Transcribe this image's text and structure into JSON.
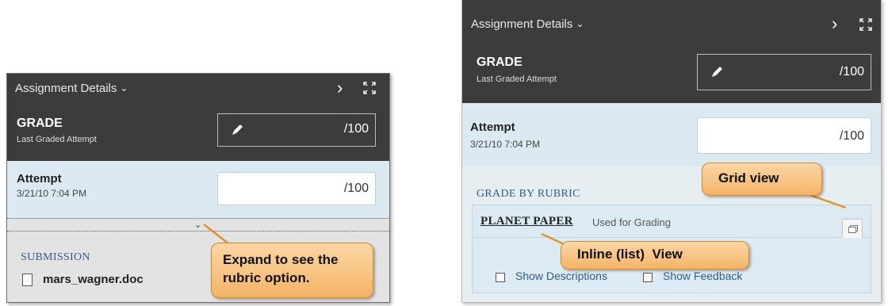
{
  "left_panel": {
    "header_title": "Assignment Details",
    "grade_label": "GRADE",
    "grade_sub": "Last Graded Attempt",
    "grade_value": "/100",
    "attempt_label": "Attempt",
    "attempt_date": "3/21/10 7:04 PM",
    "attempt_value": "/100",
    "submission_heading": "SUBMISSION",
    "file_name": "mars_wagner.doc"
  },
  "right_panel": {
    "header_title": "Assignment Details",
    "grade_label": "GRADE",
    "grade_sub": "Last Graded Attempt",
    "grade_value": "/100",
    "attempt_label": "Attempt",
    "attempt_date": "3/21/10 7:04 PM",
    "attempt_value": "/100",
    "rubric_heading": "GRADE BY RUBRIC",
    "rubric_name": "PLANET PAPER",
    "rubric_used": "Used for Grading",
    "show_descriptions": "Show Descriptions",
    "show_feedback": "Show Feedback"
  },
  "callouts": {
    "expand": "Expand to see the rubric option.",
    "grid_view": "Grid view",
    "inline_view": "Inline (list)  View"
  },
  "icons": {
    "header_chevron": "chevron-down-icon",
    "collapse": "chevron-right-icon",
    "fullscreen": "fullscreen-icon",
    "edit": "pencil-icon",
    "expand": "chevron-down-icon",
    "file": "document-icon",
    "grid_view": "grid-view-icon"
  },
  "colors": {
    "header_bg": "#3c3c3c",
    "attempt_bg": "#dbeaf2",
    "callout_orange": "#f4b466",
    "link_blue": "#2f5d8a"
  }
}
